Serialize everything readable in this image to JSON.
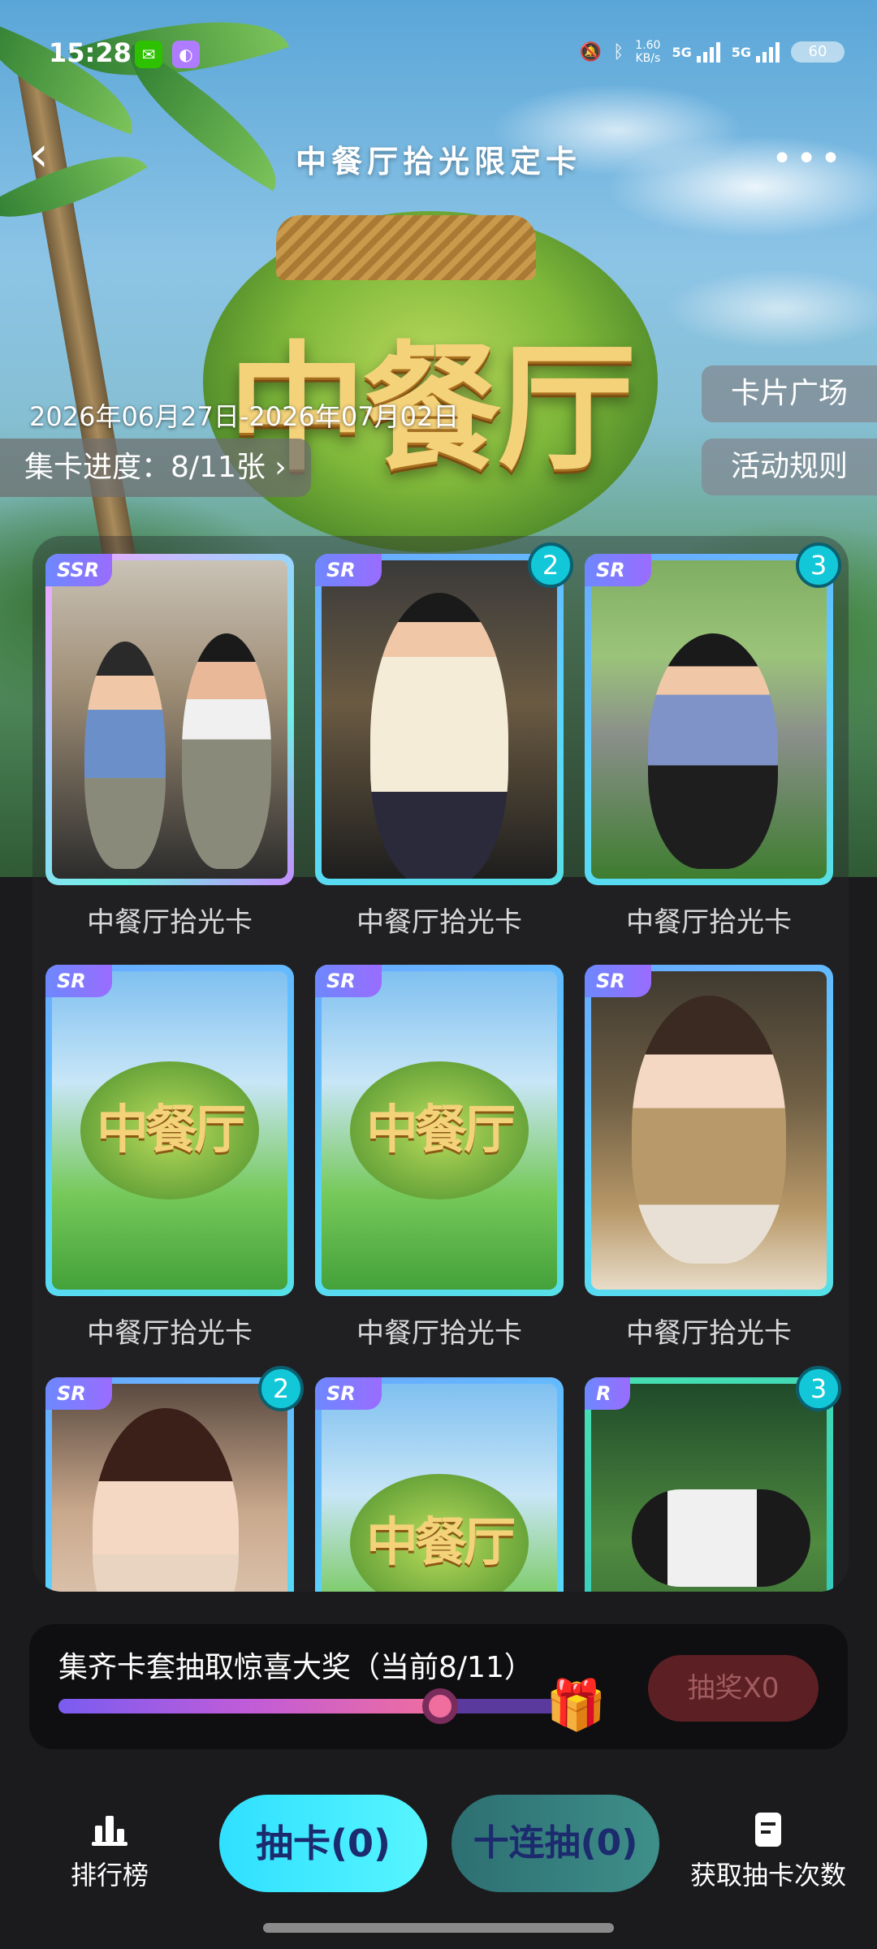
{
  "status_bar": {
    "time": "15:28",
    "speed_value": "1.60",
    "speed_unit": "KB/s",
    "net1": "5G",
    "net2": "5G",
    "battery": "60"
  },
  "header": {
    "title": "中餐厅拾光限定卡",
    "back_icon": "‹",
    "more_icon": "•••",
    "logo_text": "中餐厅"
  },
  "event": {
    "date_range": "2026年06月27日-2026年07月02日",
    "progress_label": "集卡进度：8/11张 ›",
    "card_plaza_label": "卡片广场",
    "rules_label": "活动规则"
  },
  "cards": [
    {
      "rarity": "SSR",
      "label": "中餐厅拾光卡",
      "count": ""
    },
    {
      "rarity": "SR",
      "label": "中餐厅拾光卡",
      "count": "2"
    },
    {
      "rarity": "SR",
      "label": "中餐厅拾光卡",
      "count": "3"
    },
    {
      "rarity": "SR",
      "label": "中餐厅拾光卡",
      "count": ""
    },
    {
      "rarity": "SR",
      "label": "中餐厅拾光卡",
      "count": ""
    },
    {
      "rarity": "SR",
      "label": "中餐厅拾光卡",
      "count": ""
    },
    {
      "rarity": "SR",
      "label": "",
      "count": "2"
    },
    {
      "rarity": "SR",
      "label": "",
      "count": ""
    },
    {
      "rarity": "R",
      "label": "",
      "count": "3"
    }
  ],
  "reward": {
    "text": "集齐卡套抽取惊喜大奖（当前8/11）",
    "progress_fraction": 0.727,
    "lottery_label": "抽奖X0",
    "gift_icon": "🎁"
  },
  "bottom_bar": {
    "ranking_label": "排行榜",
    "draw_label": "抽卡(0)",
    "ten_draw_label": "十连抽(0)",
    "get_chances_label": "获取抽卡次数"
  },
  "colors": {
    "accent_cyan": "#2fe0ff",
    "count_badge": "#12c8d8",
    "lottery_disabled": "#5c1f24"
  }
}
